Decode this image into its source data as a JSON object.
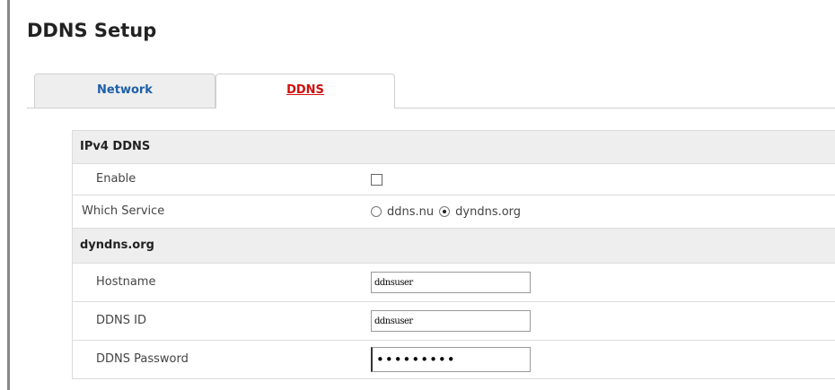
{
  "page": {
    "title": "DDNS Setup"
  },
  "tabs": [
    {
      "label": "Network",
      "active": false
    },
    {
      "label": "DDNS",
      "active": true
    }
  ],
  "ipv4": {
    "section_label": "IPv4 DDNS",
    "enable": {
      "label": "Enable",
      "checked": false
    },
    "service": {
      "label": "Which Service",
      "options": [
        "ddns.nu",
        "dyndns.org"
      ],
      "selected": "dyndns.org"
    }
  },
  "dyndns": {
    "section_label": "dyndns.org",
    "hostname": {
      "label": "Hostname",
      "value": "ddnsuser"
    },
    "ddns_id": {
      "label": "DDNS ID",
      "value": "ddnsuser"
    },
    "password": {
      "label": "DDNS Password",
      "masked_value": "•••••••••"
    }
  },
  "colors": {
    "active_tab": "#d01010",
    "inactive_tab": "#1d5fa8",
    "section_bg": "#eeeeee"
  }
}
